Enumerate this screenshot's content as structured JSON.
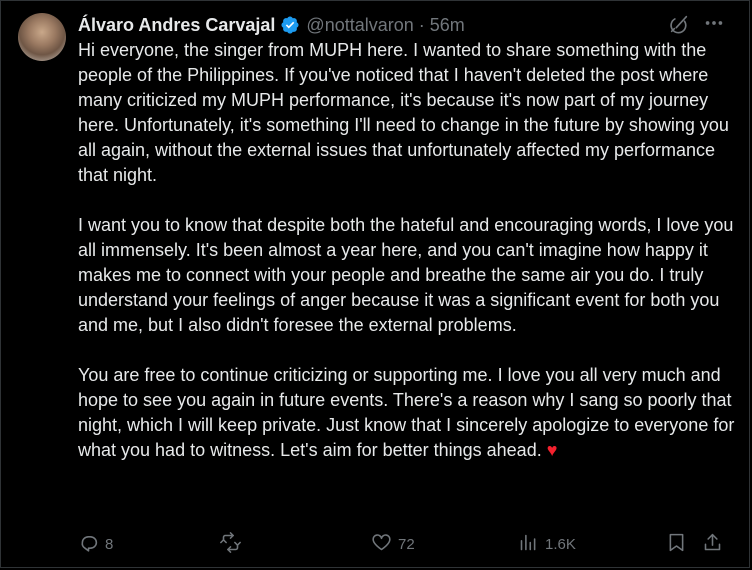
{
  "author": {
    "name": "Álvaro Andres Carvajal",
    "handle": "@nottalvaron",
    "separator": "·",
    "time": "56m",
    "verified_color": "#1d9bf0"
  },
  "post": {
    "paragraphs": [
      "Hi everyone, the singer from MUPH here. I wanted to share something with the people of the Philippines. If you've noticed that I haven't deleted the post where many criticized my MUPH performance, it's because it's now part of my journey here. Unfortunately, it's something I'll need to change in the future by showing you all again, without the external issues that unfortunately affected my performance that night.",
      "I want you to know that despite both the hateful and encouraging words, I love you all immensely. It's been almost a year here, and you can't imagine how happy it makes me to connect with your people and breathe the same air you do. I truly understand your feelings of anger because it was a significant event for both you and me, but I also didn't foresee the external problems.",
      "You are free to continue criticizing or supporting me. I love you all very much and hope to see you again in future events. There's a reason why I sang so poorly that night, which I will keep private. Just know that I sincerely apologize to everyone for what you had to witness. Let's aim for better things ahead."
    ],
    "emoji": "♥"
  },
  "actions": {
    "replies": "8",
    "reposts": "",
    "likes": "72",
    "views": "1.6K"
  },
  "icons": {
    "header": [
      "grok-icon",
      "more-icon"
    ],
    "action_bar": [
      "reply-icon",
      "repost-icon",
      "like-icon",
      "views-icon",
      "bookmark-icon",
      "share-icon"
    ]
  },
  "colors": {
    "background": "#000000",
    "text": "#e7e9ea",
    "muted": "#71767b",
    "accent": "#1d9bf0",
    "heart": "#f4212e"
  }
}
